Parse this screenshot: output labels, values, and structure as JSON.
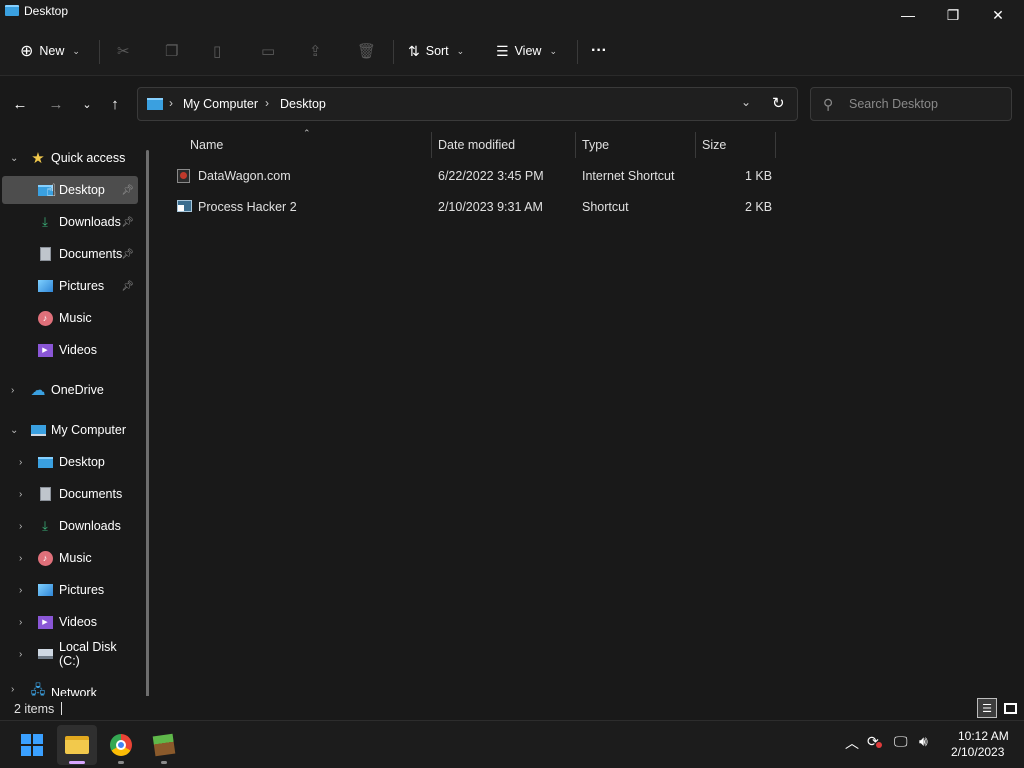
{
  "window": {
    "title": "Desktop",
    "minimize_glyph": "—",
    "maximize_glyph": "❐",
    "close_glyph": "✕"
  },
  "toolbar": {
    "new_label": "New",
    "sort_label": "Sort",
    "view_label": "View",
    "more_glyph": "···",
    "icons": [
      "new-icon",
      "cut-icon",
      "copy-icon",
      "paste-icon",
      "rename-icon",
      "share-icon",
      "delete-icon",
      "sort-icon",
      "view-icon",
      "more-icon"
    ]
  },
  "address": {
    "crumbs": [
      "My Computer",
      "Desktop"
    ],
    "search_placeholder": "Search Desktop"
  },
  "sidebar": {
    "quick_access": {
      "label": "Quick access",
      "items": [
        {
          "label": "Desktop",
          "icon": "desktop-icon",
          "pinned": true,
          "selected": true
        },
        {
          "label": "Downloads",
          "icon": "download-icon",
          "pinned": true
        },
        {
          "label": "Documents",
          "icon": "document-icon",
          "pinned": true
        },
        {
          "label": "Pictures",
          "icon": "pictures-icon",
          "pinned": true
        },
        {
          "label": "Music",
          "icon": "music-icon",
          "pinned": false
        },
        {
          "label": "Videos",
          "icon": "videos-icon",
          "pinned": false
        }
      ]
    },
    "onedrive": {
      "label": "OneDrive"
    },
    "my_computer": {
      "label": "My Computer",
      "items": [
        {
          "label": "Desktop",
          "icon": "desktop-icon"
        },
        {
          "label": "Documents",
          "icon": "document-icon"
        },
        {
          "label": "Downloads",
          "icon": "download-icon"
        },
        {
          "label": "Music",
          "icon": "music-icon"
        },
        {
          "label": "Pictures",
          "icon": "pictures-icon"
        },
        {
          "label": "Videos",
          "icon": "videos-icon"
        },
        {
          "label": "Local Disk (C:)",
          "icon": "drive-icon"
        }
      ]
    },
    "network": {
      "label": "Network"
    }
  },
  "file_list": {
    "columns": [
      "Name",
      "Date modified",
      "Type",
      "Size"
    ],
    "rows": [
      {
        "name": "DataWagon.com",
        "date": "6/22/2022 3:45 PM",
        "type": "Internet Shortcut",
        "size": "1 KB",
        "icon": "internet-shortcut-icon"
      },
      {
        "name": "Process Hacker 2",
        "date": "2/10/2023 9:31 AM",
        "type": "Shortcut",
        "size": "2 KB",
        "icon": "shortcut-icon"
      }
    ]
  },
  "status": {
    "item_count": "2 items"
  },
  "taskbar": {
    "apps": [
      "start-icon",
      "file-explorer-icon",
      "chrome-icon",
      "minecraft-icon"
    ],
    "tray_icons": [
      "chevron-up-icon",
      "sync-icon",
      "network-icon",
      "volume-icon"
    ],
    "time": "10:12 AM",
    "date": "2/10/2023"
  },
  "colors": {
    "background": "#191919",
    "selection": "#4d4d4d",
    "accent_blue": "#3aa0e0",
    "folder_yellow": "#f2c94c"
  }
}
